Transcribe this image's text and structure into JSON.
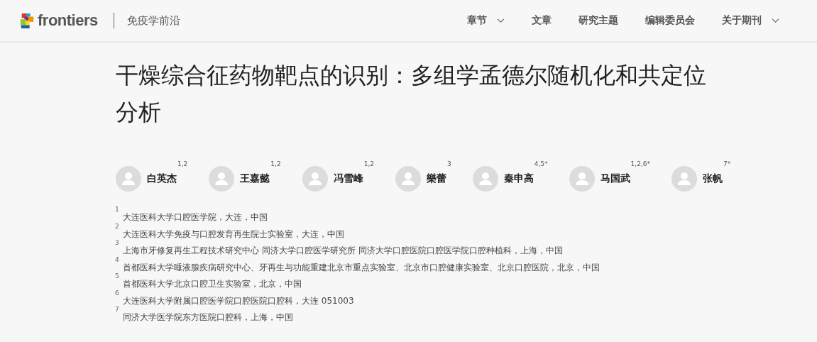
{
  "header": {
    "logo_text": "frontiers",
    "journal": "免疫学前沿",
    "nav": [
      {
        "label": "章节",
        "dropdown": true
      },
      {
        "label": "文章",
        "dropdown": false
      },
      {
        "label": "研究主题",
        "dropdown": false
      },
      {
        "label": "编辑委员会",
        "dropdown": false
      },
      {
        "label": "关于期刊",
        "dropdown": true
      }
    ]
  },
  "article": {
    "title": "干燥综合征药物靶点的识别：多组学孟德尔随机化和共定位分析",
    "authors": [
      {
        "name": "白英杰",
        "affiliations": "1,2"
      },
      {
        "name": "王嘉懿",
        "affiliations": "1,2"
      },
      {
        "name": "冯雪峰",
        "affiliations": "1,2"
      },
      {
        "name": "樂蕾",
        "affiliations": "3"
      },
      {
        "name": "秦申高",
        "affiliations": "4,5*"
      },
      {
        "name": "马国武",
        "affiliations": "1,2,6*"
      },
      {
        "name": "张帆",
        "affiliations": "7*"
      }
    ],
    "affiliations": [
      {
        "number": "1",
        "text": "大连医科大学口腔医学院，大连，中国"
      },
      {
        "number": "2",
        "text": "大连医科大学免疫与口腔发育再生院士实验室，大连，中国"
      },
      {
        "number": "3",
        "text": "上海市牙修复再生工程技术研究中心 同济大学口腔医学研究所 同济大学口腔医院口腔医学院口腔种植科，上海，中国"
      },
      {
        "number": "4",
        "text": "首都医科大学唾液腺疾病研究中心、牙再生与功能重建北京市重点实验室、北京市口腔健康实验室、北京口腔医院，北京，中国"
      },
      {
        "number": "5",
        "text": "首都医科大学北京口腔卫生实验室，北京，中国"
      },
      {
        "number": "6",
        "text": "大连医科大学附属口腔医学院口腔医院口腔科，大连 051003"
      },
      {
        "number": "7",
        "text": "同济大学医学院东方医院口腔科，上海，中国"
      }
    ]
  }
}
